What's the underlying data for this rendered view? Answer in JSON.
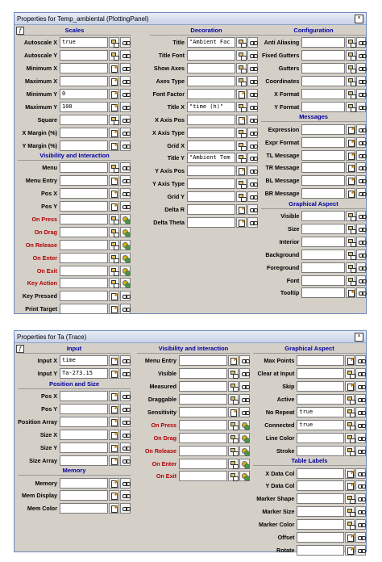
{
  "panel1": {
    "title": "Properties for Temp_ambiental (PlottingPanel)",
    "col1": {
      "sections": [
        {
          "name": "Scales",
          "rows": [
            {
              "label": "Autoscale X",
              "value": "true",
              "icons": [
                "tree",
                "link"
              ]
            },
            {
              "label": "Autoscale Y",
              "value": "",
              "icons": [
                "tree",
                "link"
              ]
            },
            {
              "label": "Minimum X",
              "value": "",
              "icons": [
                "edit",
                "link"
              ]
            },
            {
              "label": "Maximum X",
              "value": "",
              "icons": [
                "edit",
                "link"
              ]
            },
            {
              "label": "Minimum Y",
              "value": "0",
              "icons": [
                "edit",
                "link"
              ]
            },
            {
              "label": "Maximum Y",
              "value": "100",
              "icons": [
                "edit",
                "link"
              ]
            },
            {
              "label": "Square",
              "value": "",
              "icons": [
                "tree",
                "link"
              ]
            },
            {
              "label": "X Margin (%)",
              "value": "",
              "icons": [
                "edit",
                "link"
              ]
            },
            {
              "label": "Y Margin (%)",
              "value": "",
              "icons": [
                "edit",
                "link"
              ]
            }
          ]
        },
        {
          "name": "Visibility and Interaction",
          "rows": [
            {
              "label": "Menu",
              "value": "",
              "icons": [
                "tree",
                "link"
              ]
            },
            {
              "label": "Menu Entry",
              "value": "",
              "icons": [
                "edit",
                "link"
              ]
            },
            {
              "label": "Pos X",
              "value": "",
              "icons": [
                "edit",
                "link"
              ]
            },
            {
              "label": "Pos Y",
              "value": "",
              "icons": [
                "edit",
                "link"
              ]
            },
            {
              "label": "On Press",
              "value": "",
              "icons": [
                "tree",
                "act"
              ],
              "red": true
            },
            {
              "label": "On Drag",
              "value": "",
              "icons": [
                "tree",
                "act"
              ],
              "red": true
            },
            {
              "label": "On Release",
              "value": "",
              "icons": [
                "tree",
                "act"
              ],
              "red": true
            },
            {
              "label": "On Enter",
              "value": "",
              "icons": [
                "tree",
                "act"
              ],
              "red": true
            },
            {
              "label": "On Exit",
              "value": "",
              "icons": [
                "tree",
                "act"
              ],
              "red": true
            },
            {
              "label": "Key Action",
              "value": "",
              "icons": [
                "tree",
                "act"
              ],
              "red": true
            },
            {
              "label": "Key Pressed",
              "value": "",
              "icons": [
                "edit",
                "link"
              ]
            },
            {
              "label": "Print Target",
              "value": "",
              "icons": [
                "edit",
                "link"
              ]
            }
          ]
        }
      ]
    },
    "col2": {
      "sections": [
        {
          "name": "Decoration",
          "rows": [
            {
              "label": "Title",
              "value": "\"Ambient Fac",
              "icons": [
                "tree",
                "link"
              ]
            },
            {
              "label": "Title Font",
              "value": "",
              "icons": [
                "tree",
                "link"
              ]
            },
            {
              "label": "Show Axes",
              "value": "",
              "icons": [
                "tree",
                "link"
              ]
            },
            {
              "label": "Axes Type",
              "value": "",
              "icons": [
                "tree",
                "link"
              ]
            },
            {
              "label": "Font Factor",
              "value": "",
              "icons": [
                "edit",
                "link"
              ]
            },
            {
              "label": "Title X",
              "value": "\"time (h)\"",
              "icons": [
                "tree",
                "link"
              ]
            },
            {
              "label": "X Axis Pos",
              "value": "",
              "icons": [
                "edit",
                "link"
              ]
            },
            {
              "label": "X Axis Type",
              "value": "",
              "icons": [
                "tree",
                "link"
              ]
            },
            {
              "label": "Grid X",
              "value": "",
              "icons": [
                "tree",
                "link"
              ]
            },
            {
              "label": "Title Y",
              "value": "\"Ambient Tem",
              "icons": [
                "tree",
                "link"
              ]
            },
            {
              "label": "Y Axis Pos",
              "value": "",
              "icons": [
                "edit",
                "link"
              ]
            },
            {
              "label": "Y Axis Type",
              "value": "",
              "icons": [
                "tree",
                "link"
              ]
            },
            {
              "label": "Grid Y",
              "value": "",
              "icons": [
                "tree",
                "link"
              ]
            },
            {
              "label": "Delta R",
              "value": "",
              "icons": [
                "edit",
                "link"
              ]
            },
            {
              "label": "Delta Theta",
              "value": "",
              "icons": [
                "edit",
                "link"
              ]
            }
          ]
        }
      ]
    },
    "col3": {
      "sections": [
        {
          "name": "Configuration",
          "rows": [
            {
              "label": "Anti Aliasing",
              "value": "",
              "icons": [
                "tree",
                "link"
              ]
            },
            {
              "label": "Fixed Gutters",
              "value": "",
              "icons": [
                "tree",
                "link"
              ]
            },
            {
              "label": "Gutters",
              "value": "",
              "icons": [
                "tree",
                "link"
              ]
            },
            {
              "label": "Coordinates",
              "value": "",
              "icons": [
                "tree",
                "link"
              ]
            },
            {
              "label": "X Format",
              "value": "",
              "icons": [
                "tree",
                "link"
              ]
            },
            {
              "label": "Y Format",
              "value": "",
              "icons": [
                "tree",
                "link"
              ]
            }
          ]
        },
        {
          "name": "Messages",
          "rows": [
            {
              "label": "Expression",
              "value": "",
              "icons": [
                "edit",
                "link"
              ]
            },
            {
              "label": "Expr Format",
              "value": "",
              "icons": [
                "edit",
                "link"
              ]
            },
            {
              "label": "TL Message",
              "value": "",
              "icons": [
                "edit",
                "link"
              ]
            },
            {
              "label": "TR Message",
              "value": "",
              "icons": [
                "edit",
                "link"
              ]
            },
            {
              "label": "BL Message",
              "value": "",
              "icons": [
                "edit",
                "link"
              ]
            },
            {
              "label": "BR Message",
              "value": "",
              "icons": [
                "edit",
                "link"
              ]
            }
          ]
        },
        {
          "name": "Graphical Aspect",
          "rows": [
            {
              "label": "Visible",
              "value": "",
              "icons": [
                "tree",
                "link"
              ]
            },
            {
              "label": "Size",
              "value": "",
              "icons": [
                "tree",
                "link"
              ]
            },
            {
              "label": "Interior",
              "value": "",
              "icons": [
                "tree",
                "link"
              ]
            },
            {
              "label": "Background",
              "value": "",
              "icons": [
                "tree",
                "link"
              ]
            },
            {
              "label": "Foreground",
              "value": "",
              "icons": [
                "tree",
                "link"
              ]
            },
            {
              "label": "Font",
              "value": "",
              "icons": [
                "tree",
                "link"
              ]
            },
            {
              "label": "Tooltip",
              "value": "",
              "icons": [
                "edit",
                "link"
              ]
            }
          ]
        }
      ]
    }
  },
  "panel2": {
    "title": "Properties for Ta (Trace)",
    "col1": {
      "sections": [
        {
          "name": "Input",
          "rows": [
            {
              "label": "Input X",
              "value": "time",
              "icons": [
                "edit",
                "link"
              ]
            },
            {
              "label": "Input Y",
              "value": "Ta-273.15",
              "icons": [
                "edit",
                "link"
              ]
            }
          ]
        },
        {
          "name": "Position and Size",
          "rows": [
            {
              "label": "Pos X",
              "value": "",
              "icons": [
                "edit",
                "link"
              ]
            },
            {
              "label": "Pos Y",
              "value": "",
              "icons": [
                "edit",
                "link"
              ]
            },
            {
              "label": "Position Array",
              "value": "",
              "icons": [
                "edit",
                "link"
              ]
            },
            {
              "label": "Size X",
              "value": "",
              "icons": [
                "edit",
                "link"
              ]
            },
            {
              "label": "Size Y",
              "value": "",
              "icons": [
                "edit",
                "link"
              ]
            },
            {
              "label": "Size Array",
              "value": "",
              "icons": [
                "edit",
                "link"
              ]
            }
          ]
        },
        {
          "name": "Memory",
          "rows": [
            {
              "label": "Memory",
              "value": "",
              "icons": [
                "edit",
                "link"
              ]
            },
            {
              "label": "Mem Display",
              "value": "",
              "icons": [
                "edit",
                "link"
              ]
            },
            {
              "label": "Mem Color",
              "value": "",
              "icons": [
                "edit",
                "link"
              ]
            }
          ]
        }
      ]
    },
    "col2": {
      "sections": [
        {
          "name": "Visibility and Interaction",
          "rows": [
            {
              "label": "Menu Entry",
              "value": "",
              "icons": [
                "edit",
                "link"
              ]
            },
            {
              "label": "Visible",
              "value": "",
              "icons": [
                "tree",
                "link"
              ]
            },
            {
              "label": "Measured",
              "value": "",
              "icons": [
                "tree",
                "link"
              ]
            },
            {
              "label": "Draggable",
              "value": "",
              "icons": [
                "tree",
                "link"
              ]
            },
            {
              "label": "Sensitivity",
              "value": "",
              "icons": [
                "edit",
                "link"
              ]
            },
            {
              "label": "On Press",
              "value": "",
              "icons": [
                "tree",
                "act"
              ],
              "red": true
            },
            {
              "label": "On Drag",
              "value": "",
              "icons": [
                "tree",
                "act"
              ],
              "red": true
            },
            {
              "label": "On Release",
              "value": "",
              "icons": [
                "tree",
                "act"
              ],
              "red": true
            },
            {
              "label": "On Enter",
              "value": "",
              "icons": [
                "tree",
                "act"
              ],
              "red": true
            },
            {
              "label": "On Exit",
              "value": "",
              "icons": [
                "tree",
                "act"
              ],
              "red": true
            }
          ]
        }
      ]
    },
    "col3": {
      "sections": [
        {
          "name": "Graphical Aspect",
          "rows": [
            {
              "label": "Max Points",
              "value": "",
              "icons": [
                "edit",
                "link"
              ]
            },
            {
              "label": "Clear at Input",
              "value": "",
              "icons": [
                "tree",
                "link"
              ]
            },
            {
              "label": "Skip",
              "value": "",
              "icons": [
                "edit",
                "link"
              ]
            },
            {
              "label": "Active",
              "value": "",
              "icons": [
                "tree",
                "link"
              ]
            },
            {
              "label": "No Repeat",
              "value": "true",
              "icons": [
                "tree",
                "link"
              ]
            },
            {
              "label": "Connected",
              "value": "true",
              "icons": [
                "tree",
                "link"
              ]
            },
            {
              "label": "Line Color",
              "value": "",
              "icons": [
                "tree",
                "link"
              ]
            },
            {
              "label": "Stroke",
              "value": "",
              "icons": [
                "tree",
                "link"
              ]
            }
          ]
        },
        {
          "name": "Table Labels",
          "rows": [
            {
              "label": "X Data Col",
              "value": "",
              "icons": [
                "edit",
                "link"
              ]
            },
            {
              "label": "Y Data Col",
              "value": "",
              "icons": [
                "edit",
                "link"
              ]
            },
            {
              "label": "Marker Shape",
              "value": "",
              "icons": [
                "tree",
                "link"
              ]
            },
            {
              "label": "Marker Size",
              "value": "",
              "icons": [
                "tree",
                "link"
              ]
            },
            {
              "label": "Marker Color",
              "value": "",
              "icons": [
                "tree",
                "link"
              ]
            },
            {
              "label": "Offset",
              "value": "",
              "icons": [
                "edit",
                "link"
              ]
            },
            {
              "label": "Rotate",
              "value": "",
              "icons": [
                "edit",
                "link"
              ]
            }
          ]
        }
      ]
    }
  },
  "common": {
    "close_glyph": "×",
    "f_glyph": "f"
  }
}
